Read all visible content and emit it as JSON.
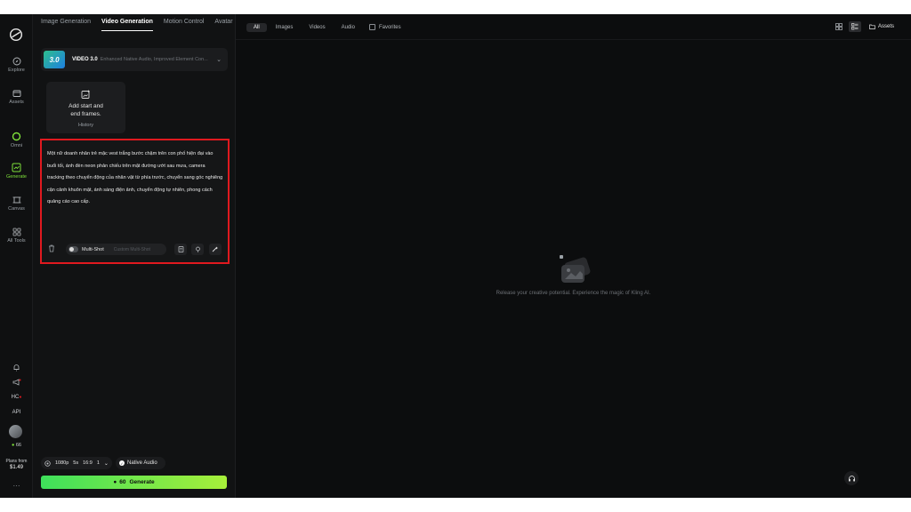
{
  "rail": {
    "items": [
      {
        "label": "Explore",
        "icon": "compass-icon"
      },
      {
        "label": "Assets",
        "icon": "folder-icon"
      },
      {
        "label": "Omni",
        "icon": "omni-icon"
      },
      {
        "label": "Generate",
        "icon": "generate-icon"
      },
      {
        "label": "Canvas",
        "icon": "canvas-icon"
      },
      {
        "label": "All Tools",
        "icon": "grid-icon"
      }
    ],
    "hc_label": "HC",
    "api_label": "API",
    "credits": "66",
    "plans_label": "Plans from",
    "plans_price": "$1.49"
  },
  "panel": {
    "tabs": [
      "Image Generation",
      "Video Generation",
      "Motion Control",
      "Avatar"
    ],
    "active_tab": "Video Generation",
    "model": {
      "badge": "3.0",
      "name": "VIDEO 3.0",
      "description": "Enhanced Native Audio, Improved Element Con..."
    },
    "frames": {
      "label_line1": "Add start and",
      "label_line2": "end frames.",
      "history": "History"
    },
    "prompt": "Một nữ doanh nhân trẻ mặc vest trắng bước chậm trên con phố hiện đại vào buổi tối, ánh đèn neon phản chiếu trên mặt đường ướt sau mưa, camera tracking theo chuyển động của nhân vật từ phía trước, chuyển sang góc nghiêng cận cảnh khuôn mặt, ánh sáng điện ảnh, chuyển động tự nhiên, phong cách quảng cáo cao cấp.",
    "multishot": {
      "label": "Multi-Shot",
      "hint": "Custom Multi-Shot"
    },
    "settings": {
      "resolution": "1080p",
      "duration": "5s",
      "ratio": "16:9",
      "count": "1"
    },
    "native_audio": "Native Audio",
    "generate": {
      "cost": "60",
      "label": "Generate"
    }
  },
  "main": {
    "filters": [
      "All",
      "Images",
      "Videos",
      "Audio"
    ],
    "active_filter": "All",
    "favorites": "Favorites",
    "assets": "Assets",
    "empty_message": "Release your creative potential. Experience the magic of Kling AI."
  },
  "colors": {
    "accent_green": "#7ee03a",
    "highlight_red": "#e0191f",
    "background": "#0c0d0e"
  }
}
